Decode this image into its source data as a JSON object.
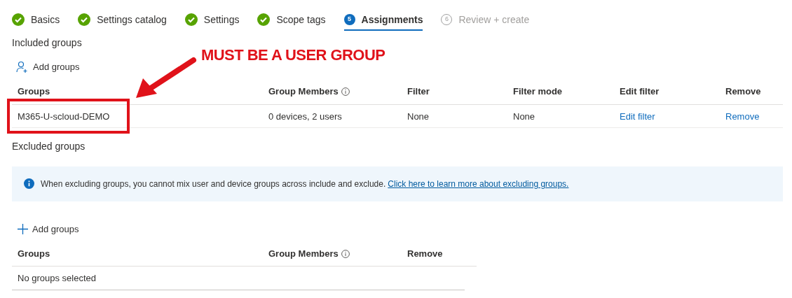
{
  "steps": [
    {
      "label": "Basics",
      "kind": "done",
      "selected": false
    },
    {
      "label": "Settings catalog",
      "kind": "done",
      "selected": false
    },
    {
      "label": "Settings",
      "kind": "done",
      "selected": false
    },
    {
      "label": "Scope tags",
      "kind": "done",
      "selected": false
    },
    {
      "label": "Assignments",
      "kind": "current",
      "number": "5",
      "selected": true
    },
    {
      "label": "Review + create",
      "kind": "pending",
      "number": "6",
      "selected": false
    }
  ],
  "included": {
    "title": "Included groups",
    "add_button": "Add groups",
    "columns": [
      {
        "label": "Groups"
      },
      {
        "label": "Group Members",
        "info": true
      },
      {
        "label": "Filter"
      },
      {
        "label": "Filter mode"
      },
      {
        "label": "Edit filter"
      },
      {
        "label": "Remove"
      }
    ],
    "rows": [
      {
        "group": "M365-U-scloud-DEMO",
        "members": "0 devices, 2 users",
        "filter": "None",
        "filter_mode": "None",
        "edit_filter": "Edit filter",
        "remove": "Remove"
      }
    ]
  },
  "excluded": {
    "title": "Excluded groups",
    "info": {
      "text": "When excluding groups, you cannot mix user and device groups across include and exclude.",
      "link": "Click here to learn more about excluding groups."
    },
    "add_button": "Add groups",
    "columns": [
      {
        "label": "Groups"
      },
      {
        "label": "Group Members",
        "info": true
      },
      {
        "label": "Remove"
      }
    ],
    "empty_text": "No groups selected"
  },
  "annotation": {
    "text": "MUST BE A USER GROUP"
  }
}
